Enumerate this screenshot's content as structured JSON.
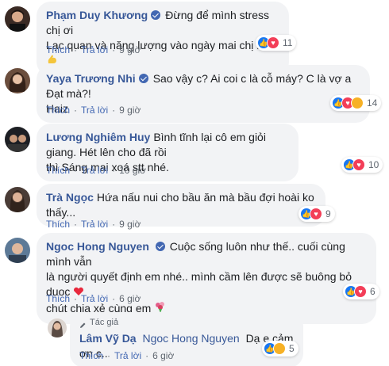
{
  "labels": {
    "like": "Thích",
    "reply": "Trả lời",
    "author_badge": "Tác giả"
  },
  "comments": [
    {
      "author": "Phạm Duy Khương",
      "verified": true,
      "text": "Đừng để mình stress chị ơi",
      "text2": "Lạc quan và năng lượng vào ngày mai chị nha",
      "time": "9 giờ",
      "reaction_count": "11"
    },
    {
      "author": "Yaya Trương Nhi",
      "verified": true,
      "text": "Sao vậy c? Ai coi c là cỗ máy? C là vợ a Đạt mà?!",
      "text2": "Haiz",
      "time": "9 giờ",
      "reaction_count": "14"
    },
    {
      "author": "Lương Nghiêm Huy",
      "text": "Bình tĩnh lại cô em giỏi giang. Hét lên cho đã rồi",
      "text2": "thì Sáng mai xoá stt nhé.",
      "time": "10 giờ",
      "reaction_count": "10"
    },
    {
      "author": "Trà Ngọc",
      "text": "Hứa nấu nui cho bầu ăn mà bầu đợi hoài ko thấy...",
      "time": "9 giờ",
      "reaction_count": "9"
    },
    {
      "author": "Ngoc Hong Nguyen",
      "text": "Cuộc sống luôn như thế.. cuối cùng mình vẫn",
      "text2": "là người quyết định em nhé.. mình cầm lên được sẽ buông bỏ duoc",
      "text3": "chút chia xẻ cùng em",
      "time": "6 giờ",
      "reaction_count": "6"
    }
  ],
  "reply": {
    "author": "Lâm Vỹ Dạ",
    "mention": "Ngoc Hong Nguyen",
    "text": "Dạ e cảm ơn c..",
    "time": "6 giờ",
    "reaction_count": "5"
  },
  "colors": {
    "link": "#385898",
    "bubble": "#f2f3f5",
    "like": "#1877f2",
    "love": "#f33e58",
    "sad": "#f7b125"
  }
}
